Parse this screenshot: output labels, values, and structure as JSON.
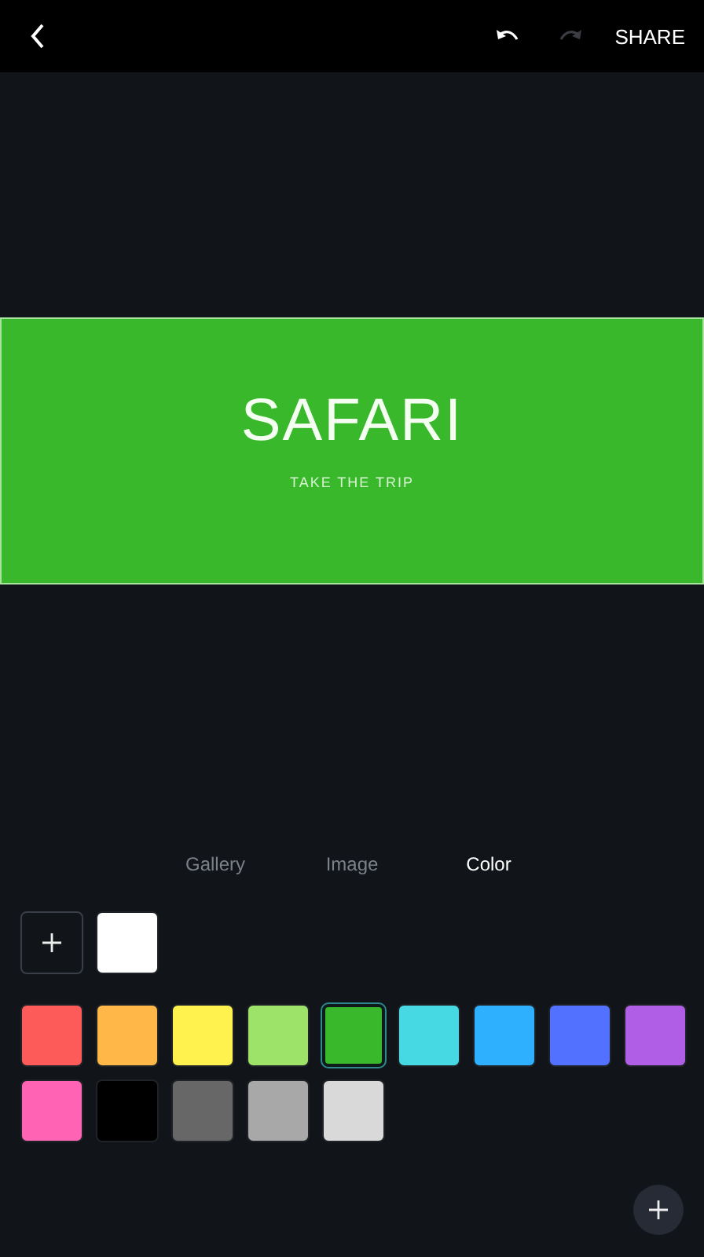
{
  "toolbar": {
    "undo": {
      "disabled": false
    },
    "redo": {
      "disabled": true
    },
    "share": "SHARE"
  },
  "banner": {
    "color": "#39b82c",
    "title": "SAFARI",
    "subtitle": "TAKE THE TRIP"
  },
  "tabs": [
    {
      "label": "Gallery",
      "selected": false
    },
    {
      "label": "Image",
      "selected": false
    },
    {
      "label": "Color",
      "selected": true
    }
  ],
  "custom_colors": [
    {
      "color": "#ffffff",
      "selected": false
    }
  ],
  "swatches": [
    {
      "color": "#fd5a5a",
      "selected": false
    },
    {
      "color": "#ffb748",
      "selected": false
    },
    {
      "color": "#fff24e",
      "selected": false
    },
    {
      "color": "#9de369",
      "selected": false
    },
    {
      "color": "#39b82c",
      "selected": true
    },
    {
      "color": "#46d9e4",
      "selected": false
    },
    {
      "color": "#2eb0ff",
      "selected": false
    },
    {
      "color": "#5271ff",
      "selected": false
    },
    {
      "color": "#b15ee7",
      "selected": false
    },
    {
      "color": "#ff63b4",
      "selected": false
    },
    {
      "color": "#000000",
      "selected": false
    },
    {
      "color": "#676767",
      "selected": false
    },
    {
      "color": "#a8a8a8",
      "selected": false
    },
    {
      "color": "#d9d9d9",
      "selected": false
    }
  ]
}
